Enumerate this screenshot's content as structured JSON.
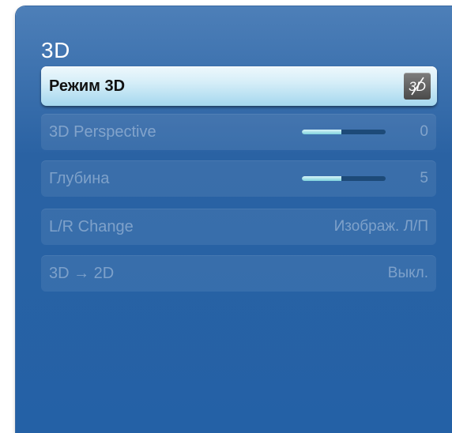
{
  "menu": {
    "title": "3D",
    "items": [
      {
        "label": "Режим 3D",
        "icon": "3d-off-icon",
        "icon_text": "3D"
      },
      {
        "label": "3D Perspective",
        "value": "0",
        "slider_fraction": 0.47
      },
      {
        "label": "Глубина",
        "value": "5",
        "slider_fraction": 0.47
      },
      {
        "label": "L/R Change",
        "value": "Изображ. Л/П"
      },
      {
        "label": "3D → 2D",
        "value": "Выкл."
      }
    ]
  },
  "colors": {
    "panel": "#2a62a3",
    "selected_row": "#d6eef8",
    "slider_fill": "#7fd2dd",
    "slider_track": "#1d4a78"
  }
}
